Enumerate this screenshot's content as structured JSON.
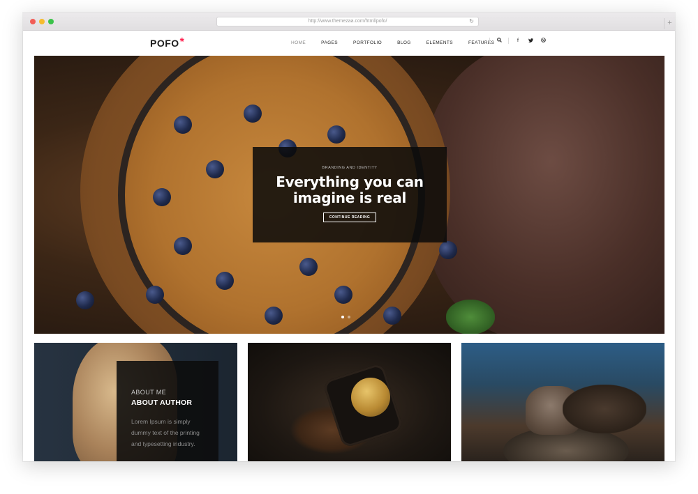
{
  "browser": {
    "url": "http://www.themezaa.com/html/pofo/"
  },
  "header": {
    "logo": "POFO",
    "logo_mark": "*",
    "nav": [
      "HOME",
      "PAGES",
      "PORTFOLIO",
      "BLOG",
      "ELEMENTS",
      "FEATURES"
    ],
    "active_nav": "HOME",
    "icons": [
      "search-icon",
      "facebook-icon",
      "twitter-icon",
      "dribbble-icon"
    ]
  },
  "hero": {
    "kicker": "BRANDING AND IDENTITY",
    "title_line1": "Everything you can",
    "title_line2": "imagine is real",
    "button": "CONTINUE READING",
    "slides": 2,
    "active_slide": 1
  },
  "cards": {
    "about": {
      "small": "ABOUT ME",
      "title": "ABOUT AUTHOR",
      "body": "Lorem Ipsum is simply dummy text of the printing and typesetting industry."
    }
  },
  "colors": {
    "accent": "#ff214f",
    "overlay": "#0a0a0a"
  }
}
